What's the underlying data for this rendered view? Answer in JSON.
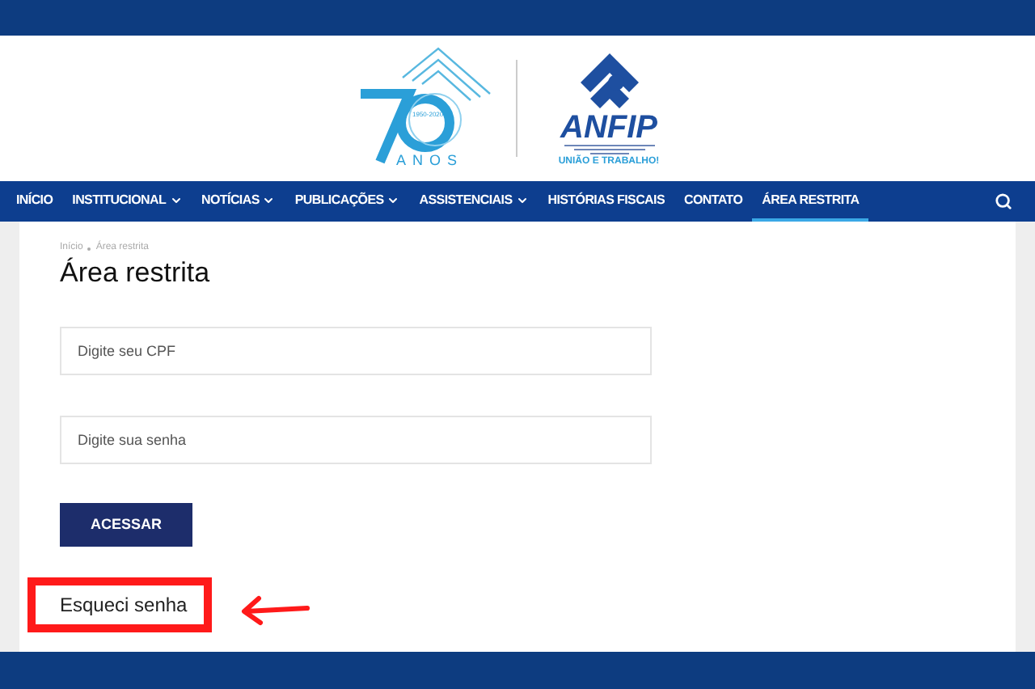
{
  "logo": {
    "years": "1950-2020",
    "anos": "ANOS",
    "brand": "ANFIP",
    "motto": "UNIÃO E TRABALHO!"
  },
  "nav": {
    "items": [
      {
        "label": "INÍCIO",
        "dropdown": false,
        "selected": false
      },
      {
        "label": "INSTITUCIONAL",
        "dropdown": true,
        "selected": false
      },
      {
        "label": "NOTÍCIAS",
        "dropdown": true,
        "selected": false
      },
      {
        "label": "PUBLICAÇÕES",
        "dropdown": true,
        "selected": false
      },
      {
        "label": "ASSISTENCIAIS",
        "dropdown": true,
        "selected": false
      },
      {
        "label": "HISTÓRIAS FISCAIS",
        "dropdown": false,
        "selected": false
      },
      {
        "label": "CONTATO",
        "dropdown": false,
        "selected": false
      },
      {
        "label": "ÁREA RESTRITA",
        "dropdown": false,
        "selected": true
      }
    ]
  },
  "breadcrumb": [
    "Início",
    "Área restrita"
  ],
  "title": "Área restrita",
  "form": {
    "fields": [
      {
        "placeholder": "Digite seu CPF"
      },
      {
        "placeholder": "Digite sua senha"
      }
    ],
    "button": "ACESSAR",
    "forgot_link": "Esqueci senha"
  }
}
